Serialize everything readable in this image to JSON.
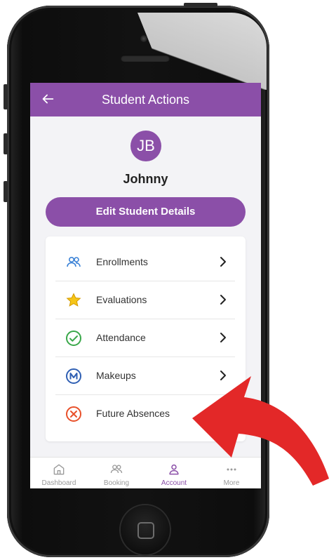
{
  "appbar": {
    "title": "Student Actions"
  },
  "student": {
    "initials": "JB",
    "name": "Johnny"
  },
  "edit_button": {
    "label": "Edit Student Details"
  },
  "actions": [
    {
      "label": "Enrollments",
      "icon": "people-icon",
      "has_chevron": true
    },
    {
      "label": "Evaluations",
      "icon": "star-icon",
      "has_chevron": true
    },
    {
      "label": "Attendance",
      "icon": "check-circle-icon",
      "has_chevron": true
    },
    {
      "label": "Makeups",
      "icon": "m-circle-icon",
      "has_chevron": true
    },
    {
      "label": "Future Absences",
      "icon": "x-circle-icon",
      "has_chevron": false
    }
  ],
  "bottom_nav": [
    {
      "label": "Dashboard",
      "icon": "home-icon",
      "active": false
    },
    {
      "label": "Booking",
      "icon": "people-icon",
      "active": false
    },
    {
      "label": "Account",
      "icon": "person-icon",
      "active": true
    },
    {
      "label": "More",
      "icon": "more-icon",
      "active": false
    }
  ],
  "colors": {
    "accent": "#8b4fa8",
    "arrow": "#e32828",
    "evaluations_star": "#f5c518",
    "attendance": "#3aa84a",
    "makeups": "#2f5fb3",
    "absences": "#e8502a"
  }
}
